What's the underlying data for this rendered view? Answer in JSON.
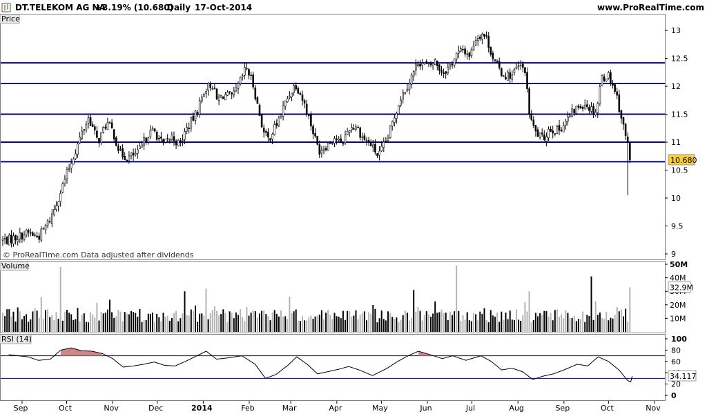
{
  "header": {
    "instrument": "DT.TELEKOM AG NA",
    "change": "+3.19% (10.680)",
    "period": "Daily",
    "date": "17-Oct-2014",
    "site": "www.ProRealTime.com"
  },
  "watermark": "© ProRealTime.com  Data adjusted after dividends",
  "colors": {
    "hline": "#000080",
    "volume_dark": "#000000",
    "volume_light": "#b4b4b4",
    "rsi_fill": "#cc8888",
    "price_tag": "#f7d038"
  },
  "chart_data": [
    {
      "type": "candlestick",
      "panel": "Price",
      "ylim": [
        9,
        13.1
      ],
      "y_ticks": [
        "9",
        "9.5",
        "10",
        "10.5",
        "11",
        "11.5",
        "12",
        "12.5",
        "13"
      ],
      "horizontal_lines": [
        12.42,
        12.05,
        11.5,
        11.0,
        10.65
      ],
      "last_price_label": "10.680",
      "last_price": 10.68,
      "x_labels": [
        "Sep",
        "Oct",
        "Nov",
        "Dec",
        "2014",
        "Feb",
        "Mar",
        "Apr",
        "May",
        "Jun",
        "Jul",
        "Aug",
        "Sep",
        "Oct",
        "Nov"
      ],
      "x_label_dates": [
        "2013-09-01",
        "2013-10-01",
        "2013-11-01",
        "2013-12-01",
        "2014-01-01",
        "2014-02-01",
        "2014-03-01",
        "2014-04-01",
        "2014-05-01",
        "2014-06-01",
        "2014-07-01",
        "2014-08-01",
        "2014-09-01",
        "2014-10-01",
        "2014-11-01"
      ],
      "close_path": [
        [
          "2013-08-23",
          9.25
        ],
        [
          "2013-09-05",
          9.38
        ],
        [
          "2013-09-12",
          9.3
        ],
        [
          "2013-09-20",
          9.62
        ],
        [
          "2013-09-26",
          10.05
        ],
        [
          "2013-09-30",
          10.35
        ],
        [
          "2013-10-07",
          10.85
        ],
        [
          "2013-10-11",
          11.15
        ],
        [
          "2013-10-16",
          11.45
        ],
        [
          "2013-10-22",
          11.0
        ],
        [
          "2013-10-28",
          11.35
        ],
        [
          "2013-11-01",
          11.2
        ],
        [
          "2013-11-06",
          10.8
        ],
        [
          "2013-11-11",
          10.72
        ],
        [
          "2013-11-18",
          10.8
        ],
        [
          "2013-11-25",
          11.15
        ],
        [
          "2013-11-29",
          11.2
        ],
        [
          "2013-12-05",
          10.95
        ],
        [
          "2013-12-11",
          11.1
        ],
        [
          "2013-12-16",
          10.95
        ],
        [
          "2013-12-20",
          11.2
        ],
        [
          "2013-12-27",
          11.5
        ],
        [
          "2014-01-02",
          11.95
        ],
        [
          "2014-01-07",
          12.05
        ],
        [
          "2014-01-10",
          11.75
        ],
        [
          "2014-01-15",
          11.85
        ],
        [
          "2014-01-21",
          11.8
        ],
        [
          "2014-01-27",
          12.15
        ],
        [
          "2014-01-30",
          12.35
        ],
        [
          "2014-02-04",
          12.0
        ],
        [
          "2014-02-07",
          11.6
        ],
        [
          "2014-02-11",
          11.15
        ],
        [
          "2014-02-14",
          11.05
        ],
        [
          "2014-02-20",
          11.35
        ],
        [
          "2014-02-26",
          11.75
        ],
        [
          "2014-03-04",
          12.05
        ],
        [
          "2014-03-07",
          11.9
        ],
        [
          "2014-03-12",
          11.55
        ],
        [
          "2014-03-17",
          11.1
        ],
        [
          "2014-03-20",
          10.85
        ],
        [
          "2014-03-25",
          10.95
        ],
        [
          "2014-03-31",
          11.1
        ],
        [
          "2014-04-04",
          10.95
        ],
        [
          "2014-04-09",
          11.25
        ],
        [
          "2014-04-14",
          11.3
        ],
        [
          "2014-04-18",
          11.1
        ],
        [
          "2014-04-24",
          10.95
        ],
        [
          "2014-04-29",
          10.75
        ],
        [
          "2014-05-05",
          11.05
        ],
        [
          "2014-05-09",
          11.4
        ],
        [
          "2014-05-14",
          11.8
        ],
        [
          "2014-05-20",
          12.1
        ],
        [
          "2014-05-26",
          12.45
        ],
        [
          "2014-06-02",
          12.35
        ],
        [
          "2014-06-06",
          12.45
        ],
        [
          "2014-06-11",
          12.25
        ],
        [
          "2014-06-16",
          12.35
        ],
        [
          "2014-06-20",
          12.55
        ],
        [
          "2014-06-25",
          12.65
        ],
        [
          "2014-06-30",
          12.55
        ],
        [
          "2014-07-03",
          12.85
        ],
        [
          "2014-07-08",
          12.95
        ],
        [
          "2014-07-11",
          12.85
        ],
        [
          "2014-07-16",
          12.45
        ],
        [
          "2014-07-22",
          12.2
        ],
        [
          "2014-07-28",
          12.2
        ],
        [
          "2014-08-01",
          12.35
        ],
        [
          "2014-08-06",
          12.3
        ],
        [
          "2014-08-08",
          11.6
        ],
        [
          "2014-08-12",
          11.2
        ],
        [
          "2014-08-18",
          11.05
        ],
        [
          "2014-08-22",
          11.25
        ],
        [
          "2014-08-28",
          11.2
        ],
        [
          "2014-09-03",
          11.4
        ],
        [
          "2014-09-09",
          11.6
        ],
        [
          "2014-09-15",
          11.7
        ],
        [
          "2014-09-19",
          11.6
        ],
        [
          "2014-09-23",
          11.55
        ],
        [
          "2014-09-26",
          12.15
        ],
        [
          "2014-10-01",
          12.2
        ],
        [
          "2014-10-06",
          11.9
        ],
        [
          "2014-10-10",
          11.4
        ],
        [
          "2014-10-14",
          10.95
        ],
        [
          "2014-10-16",
          10.35
        ],
        [
          "2014-10-17",
          10.68
        ]
      ]
    },
    {
      "type": "bar",
      "panel": "Volume",
      "ylim": [
        0,
        50
      ],
      "y_ticks": [
        "10M",
        "20M",
        "30M",
        "40M",
        "50M"
      ],
      "last_value_label": "32.9M",
      "last_value": 32.9,
      "spikes": [
        [
          "2013-09-27",
          48
        ],
        [
          "2013-12-20",
          30
        ],
        [
          "2014-01-03",
          32
        ],
        [
          "2014-02-28",
          26
        ],
        [
          "2014-05-23",
          31
        ],
        [
          "2014-06-20",
          49
        ],
        [
          "2014-08-08",
          30
        ],
        [
          "2014-09-19",
          41
        ],
        [
          "2014-10-17",
          32.9
        ]
      ]
    },
    {
      "type": "line",
      "panel": "RSI (14)",
      "ylim": [
        0,
        100
      ],
      "y_ticks": [
        "0",
        "20",
        "40",
        "60",
        "80",
        "100"
      ],
      "levels": [
        30,
        70
      ],
      "last_value_label": "34.117",
      "last_value": 34.117,
      "series": [
        [
          "2013-08-23",
          72
        ],
        [
          "2013-09-05",
          68
        ],
        [
          "2013-09-12",
          62
        ],
        [
          "2013-09-20",
          64
        ],
        [
          "2013-09-27",
          80
        ],
        [
          "2013-10-04",
          84
        ],
        [
          "2013-10-11",
          79
        ],
        [
          "2013-10-18",
          78
        ],
        [
          "2013-10-25",
          74
        ],
        [
          "2013-11-01",
          65
        ],
        [
          "2013-11-08",
          50
        ],
        [
          "2013-11-15",
          52
        ],
        [
          "2013-11-22",
          55
        ],
        [
          "2013-11-29",
          59
        ],
        [
          "2013-12-06",
          53
        ],
        [
          "2013-12-13",
          52
        ],
        [
          "2013-12-20",
          60
        ],
        [
          "2014-01-03",
          78
        ],
        [
          "2014-01-10",
          64
        ],
        [
          "2014-01-17",
          66
        ],
        [
          "2014-01-27",
          70
        ],
        [
          "2014-02-05",
          55
        ],
        [
          "2014-02-12",
          30
        ],
        [
          "2014-02-19",
          37
        ],
        [
          "2014-02-27",
          53
        ],
        [
          "2014-03-05",
          68
        ],
        [
          "2014-03-12",
          55
        ],
        [
          "2014-03-19",
          38
        ],
        [
          "2014-03-26",
          42
        ],
        [
          "2014-04-02",
          46
        ],
        [
          "2014-04-09",
          51
        ],
        [
          "2014-04-16",
          45
        ],
        [
          "2014-04-25",
          35
        ],
        [
          "2014-05-05",
          48
        ],
        [
          "2014-05-12",
          60
        ],
        [
          "2014-05-19",
          70
        ],
        [
          "2014-05-26",
          78
        ],
        [
          "2014-06-04",
          71
        ],
        [
          "2014-06-11",
          65
        ],
        [
          "2014-06-18",
          70
        ],
        [
          "2014-06-27",
          62
        ],
        [
          "2014-07-07",
          70
        ],
        [
          "2014-07-14",
          60
        ],
        [
          "2014-07-21",
          45
        ],
        [
          "2014-07-28",
          48
        ],
        [
          "2014-08-04",
          42
        ],
        [
          "2014-08-11",
          28
        ],
        [
          "2014-08-18",
          34
        ],
        [
          "2014-08-25",
          38
        ],
        [
          "2014-09-01",
          45
        ],
        [
          "2014-09-10",
          55
        ],
        [
          "2014-09-17",
          52
        ],
        [
          "2014-09-24",
          68
        ],
        [
          "2014-10-01",
          60
        ],
        [
          "2014-10-08",
          45
        ],
        [
          "2014-10-14",
          26
        ],
        [
          "2014-10-16",
          24
        ],
        [
          "2014-10-17",
          34
        ]
      ]
    }
  ]
}
